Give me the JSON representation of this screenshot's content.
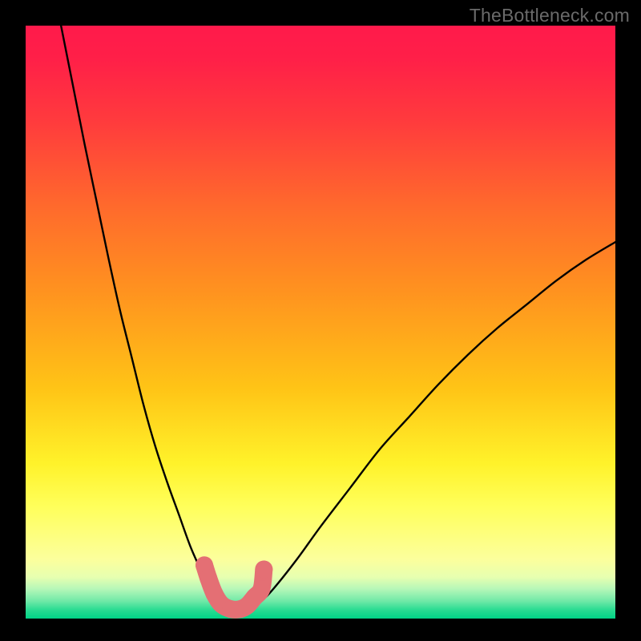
{
  "watermark": "TheBottleneck.com",
  "colors": {
    "frame": "#000000",
    "gradient_top": "#ff1a4b",
    "gradient_mid": "#ffd016",
    "gradient_bottom": "#00d487",
    "curve": "#000000",
    "marker_fill": "#e46f74",
    "marker_stroke": "#cf5c62"
  },
  "chart_data": {
    "type": "line",
    "title": "",
    "xlabel": "",
    "ylabel": "",
    "xlim": [
      0,
      100
    ],
    "ylim": [
      0,
      100
    ],
    "grid": false,
    "legend": false,
    "curve_left": {
      "description": "steep descending branch from top-left to valley floor",
      "x": [
        6,
        8,
        10,
        12,
        14,
        16,
        18,
        20,
        22,
        24,
        26,
        28,
        30,
        31,
        32,
        32.6
      ],
      "y": [
        100,
        90,
        80,
        70.5,
        61,
        52,
        44,
        36,
        29,
        23,
        17.5,
        12,
        7.5,
        5,
        3,
        1.8
      ]
    },
    "curve_right": {
      "description": "ascending branch from valley floor to upper right",
      "x": [
        38,
        40,
        42,
        46,
        50,
        55,
        60,
        65,
        70,
        75,
        80,
        85,
        90,
        95,
        100
      ],
      "y": [
        1.8,
        3,
        5,
        10,
        15.5,
        22,
        28.5,
        34,
        39.5,
        44.5,
        49,
        53,
        57,
        60.5,
        63.5
      ]
    },
    "valley_floor": {
      "x": [
        32.6,
        38
      ],
      "y": [
        1.4,
        1.4
      ]
    },
    "markers": {
      "description": "clustered rounded markers near valley",
      "points": [
        {
          "x": 30.3,
          "y": 9.0
        },
        {
          "x": 31.0,
          "y": 6.8
        },
        {
          "x": 32.0,
          "y": 4.2
        },
        {
          "x": 33.2,
          "y": 2.4
        },
        {
          "x": 34.8,
          "y": 1.6
        },
        {
          "x": 36.4,
          "y": 1.6
        },
        {
          "x": 37.6,
          "y": 2.2
        },
        {
          "x": 38.8,
          "y": 3.6
        },
        {
          "x": 40.0,
          "y": 5.0
        },
        {
          "x": 40.4,
          "y": 8.3
        }
      ]
    }
  }
}
